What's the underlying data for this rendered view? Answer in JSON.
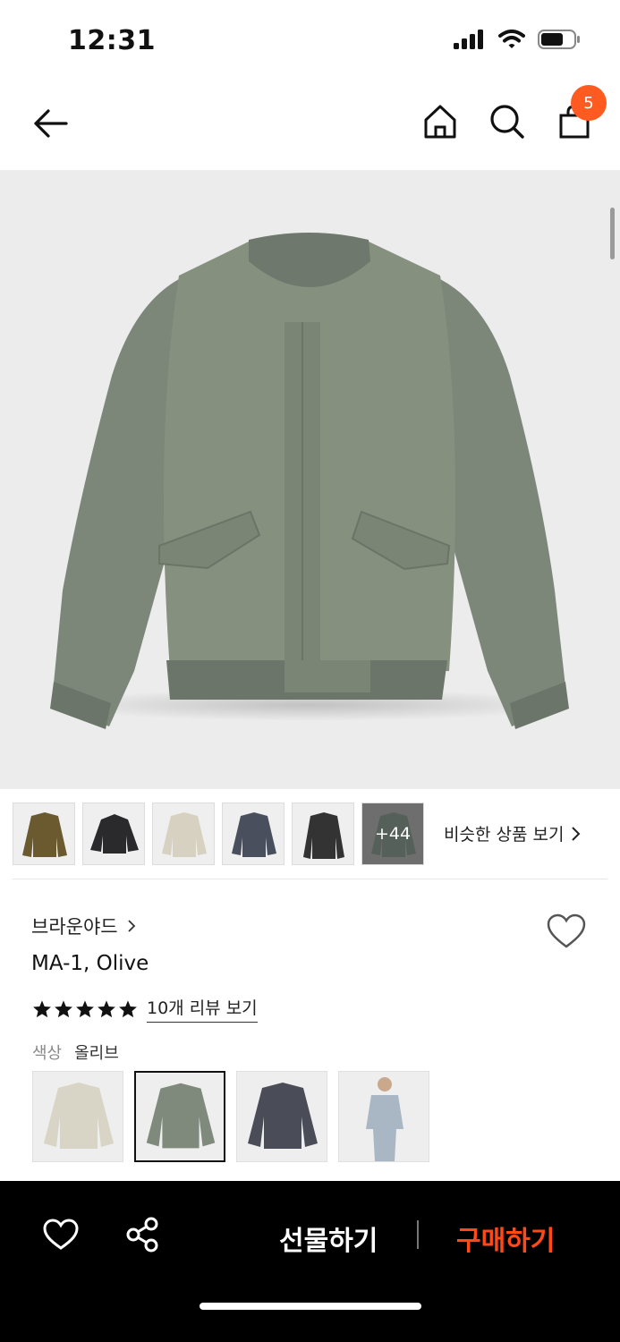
{
  "status_bar": {
    "time": "12:31",
    "icons": [
      "signal-icon",
      "wifi-icon",
      "battery-icon"
    ]
  },
  "nav": {
    "icons": [
      "back-arrow-icon",
      "home-icon",
      "search-icon",
      "shopping-bag-icon"
    ],
    "cart_count": "5"
  },
  "gallery": {
    "thumbnails": [
      {
        "name": "brown-jacket",
        "color": "#6b5a30"
      },
      {
        "name": "black-puffer",
        "color": "#2a2a2c"
      },
      {
        "name": "beige-jacket",
        "color": "#d7d1c1"
      },
      {
        "name": "navy-jacket",
        "color": "#4a4f5d"
      },
      {
        "name": "black-jacket",
        "color": "#333333"
      }
    ],
    "more_count": "+44",
    "similar_label": "비슷한 상품 보기"
  },
  "product": {
    "brand": "브라운야드",
    "name": "MA-1, Olive",
    "rating_stars": 5,
    "review_link": "10개 리뷰 보기",
    "color_label": "색상",
    "color_value": "올리브",
    "swatches": [
      {
        "name": "beige",
        "color": "#d8d4c6",
        "selected": false
      },
      {
        "name": "olive",
        "color": "#7f8a7d",
        "selected": true
      },
      {
        "name": "charcoal",
        "color": "#4a4d57",
        "selected": false
      },
      {
        "name": "light-blue-model",
        "color": "#a9b6c4",
        "selected": false
      }
    ]
  },
  "bottom_bar": {
    "gift_label": "선물하기",
    "buy_label": "구매하기"
  },
  "colors": {
    "accent": "#ff5a1f",
    "buy": "#ff4a17",
    "jacket": "#7f8a7d"
  }
}
